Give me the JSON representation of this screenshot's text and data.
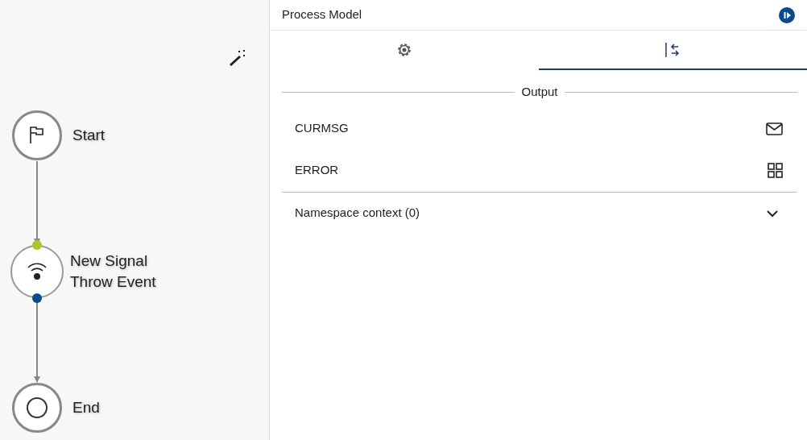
{
  "canvas": {
    "nodes": [
      {
        "kind": "start",
        "label": "Start"
      },
      {
        "kind": "signal",
        "label": "New Signal Throw Event",
        "ports": [
          {
            "color": "#a8c82a"
          },
          {
            "color": "#0b4a8b"
          }
        ]
      },
      {
        "kind": "end",
        "label": "End"
      }
    ]
  },
  "panel": {
    "title": "Process Model",
    "tabs": [
      {
        "kind": "settings",
        "selected": false
      },
      {
        "kind": "mapping",
        "selected": true
      }
    ],
    "output": {
      "legend": "Output",
      "items": [
        {
          "label": "CURMSG",
          "kind": "message"
        },
        {
          "label": "ERROR",
          "kind": "grid"
        }
      ]
    },
    "namespace": {
      "label": "Namespace context (0)",
      "expanded": false
    }
  }
}
